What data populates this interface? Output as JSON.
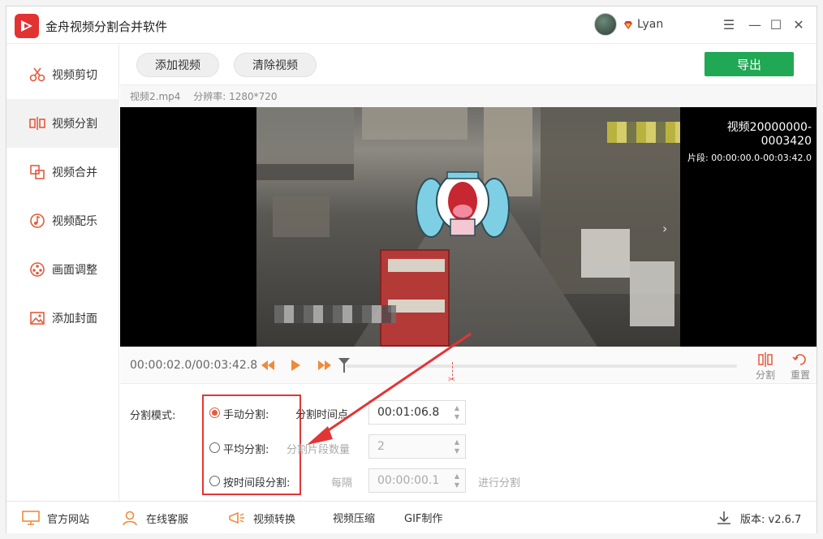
{
  "app": {
    "title": "金舟视频分割合并软件",
    "username": "Lyan"
  },
  "window_controls": {
    "menu": "☰",
    "minimize": "—",
    "maximize": "☐",
    "close": "✕"
  },
  "sidebar": {
    "items": [
      {
        "label": "视频剪切",
        "icon": "scissors-icon"
      },
      {
        "label": "视频分割",
        "icon": "split-icon",
        "active": true
      },
      {
        "label": "视频合并",
        "icon": "merge-icon"
      },
      {
        "label": "视频配乐",
        "icon": "music-icon"
      },
      {
        "label": "画面调整",
        "icon": "film-reel-icon"
      },
      {
        "label": "添加封面",
        "icon": "image-icon"
      }
    ]
  },
  "toolbar": {
    "add_video": "添加视频",
    "clear_video": "清除视频",
    "export": "导出"
  },
  "file_info": {
    "filename": "视频2.mp4",
    "resolution": "分辨率: 1280*720"
  },
  "video_overlay": {
    "clip_name": "视频20000000-0003420",
    "segment": "片段: 00:00:00.0-00:03:42.0"
  },
  "timeline": {
    "timecode": "00:00:02.0/00:03:42.8",
    "split_label": "分割",
    "reset_label": "重置"
  },
  "split_panel": {
    "mode_label": "分割模式:",
    "modes": [
      {
        "label": "手动分割:",
        "selected": true
      },
      {
        "label": "平均分割:",
        "selected": false
      },
      {
        "label": "按时间段分割:",
        "selected": false
      }
    ],
    "manual_point_label": "分割时间点",
    "manual_point_value": "00:01:06.8",
    "avg_count_label": "分割片段数量",
    "avg_count_value": "2",
    "interval_label": "每隔",
    "interval_value": "00:00:00.1",
    "interval_suffix": "进行分割"
  },
  "bottom_bar": {
    "website": "官方网站",
    "support": "在线客服",
    "convert": "视频转换",
    "compress": "视频压缩",
    "gif": "GIF制作",
    "version": "版本: v2.6.7"
  },
  "colors": {
    "accent": "#e25b3c",
    "export_green": "#21a855",
    "highlight_red": "#e33535"
  }
}
